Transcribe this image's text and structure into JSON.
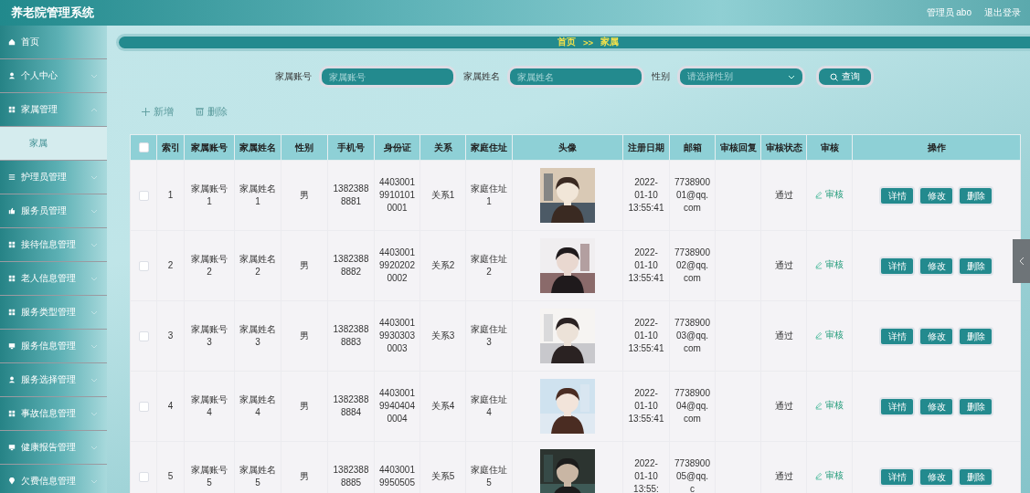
{
  "header": {
    "title": "养老院管理系统",
    "user": "管理员 abo",
    "logout": "退出登录"
  },
  "sidebar": {
    "items": [
      {
        "label": "首页",
        "selected": false
      },
      {
        "label": "个人中心",
        "selected": false,
        "expanded": false
      },
      {
        "label": "家属管理",
        "selected": false,
        "expanded": true,
        "children": [
          {
            "label": "家属",
            "selected": true
          }
        ]
      },
      {
        "label": "护理员管理",
        "selected": false,
        "expanded": false
      },
      {
        "label": "服务员管理",
        "selected": false,
        "expanded": false
      },
      {
        "label": "接待信息管理",
        "selected": false,
        "expanded": false
      },
      {
        "label": "老人信息管理",
        "selected": false,
        "expanded": false
      },
      {
        "label": "服务类型管理",
        "selected": false,
        "expanded": false
      },
      {
        "label": "服务信息管理",
        "selected": false,
        "expanded": false
      },
      {
        "label": "服务选择管理",
        "selected": false,
        "expanded": false
      },
      {
        "label": "事故信息管理",
        "selected": false,
        "expanded": false
      },
      {
        "label": "健康报告管理",
        "selected": false,
        "expanded": false
      },
      {
        "label": "欠费信息管理",
        "selected": false,
        "expanded": false
      }
    ]
  },
  "breadcrumb": {
    "home": "首页",
    "separator": ">>",
    "current": "家属"
  },
  "search": {
    "fields": [
      {
        "kind": "text",
        "label": "家属账号",
        "placeholder": "家属账号"
      },
      {
        "kind": "text",
        "label": "家属姓名",
        "placeholder": "家属姓名"
      },
      {
        "kind": "select",
        "label": "性别",
        "placeholder": "请选择性别"
      }
    ],
    "button": "查询"
  },
  "toolbar": {
    "add": "新增",
    "delete": "删除"
  },
  "table": {
    "header_checked": false,
    "columns": [
      "索引",
      "家属账号",
      "家属姓名",
      "性别",
      "手机号",
      "身份证",
      "关系",
      "家庭住址",
      "头像",
      "注册日期",
      "邮箱",
      "审核回复",
      "审核状态",
      "审核",
      "操作"
    ],
    "rows": [
      {
        "checked": false,
        "index": "1",
        "account": "家属账号1",
        "name": "家属姓名1",
        "gender": "男",
        "phone": "13823888881",
        "id_card": "440300199101010001",
        "relation": "关系1",
        "address": "家庭住址1",
        "date": "2022-01-10 13:55:41",
        "email": "773890001@qq.com",
        "status": "通过",
        "review": "审核",
        "actions": [
          "详情",
          "修改",
          "删除"
        ]
      },
      {
        "checked": false,
        "index": "2",
        "account": "家属账号2",
        "name": "家属姓名2",
        "gender": "男",
        "phone": "13823888882",
        "id_card": "440300199202020002",
        "relation": "关系2",
        "address": "家庭住址2",
        "date": "2022-01-10 13:55:41",
        "email": "773890002@qq.com",
        "status": "通过",
        "review": "审核",
        "actions": [
          "详情",
          "修改",
          "删除"
        ]
      },
      {
        "checked": false,
        "index": "3",
        "account": "家属账号3",
        "name": "家属姓名3",
        "gender": "男",
        "phone": "13823888883",
        "id_card": "440300199303030003",
        "relation": "关系3",
        "address": "家庭住址3",
        "date": "2022-01-10 13:55:41",
        "email": "773890003@qq.com",
        "status": "通过",
        "review": "审核",
        "actions": [
          "详情",
          "修改",
          "删除"
        ]
      },
      {
        "checked": false,
        "index": "4",
        "account": "家属账号4",
        "name": "家属姓名4",
        "gender": "男",
        "phone": "13823888884",
        "id_card": "440300199404040004",
        "relation": "关系4",
        "address": "家庭住址4",
        "date": "2022-01-10 13:55:41",
        "email": "773890004@qq.com",
        "status": "通过",
        "review": "审核",
        "actions": [
          "详情",
          "修改",
          "删除"
        ]
      },
      {
        "checked": false,
        "index": "5",
        "account": "家属账号5",
        "name": "家属姓名5",
        "gender": "男",
        "phone": "13823888885",
        "id_card": "44030019950505",
        "relation": "关系5",
        "address": "家庭住址5",
        "date": "2022-01-10 13:55:",
        "email": "773890005@qq.c",
        "status": "通过",
        "review": "审核",
        "actions": [
          "详情",
          "修改",
          "删除"
        ]
      }
    ]
  }
}
